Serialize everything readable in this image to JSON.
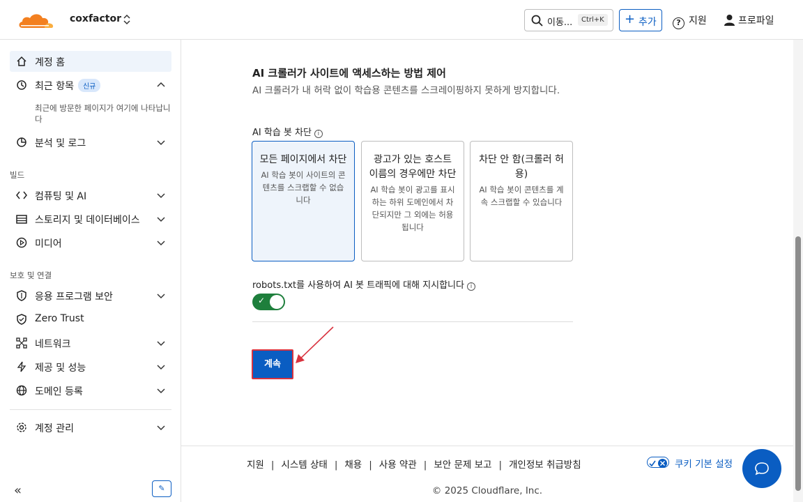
{
  "topbar": {
    "account_name": "coxfactor",
    "search_label": "이동...",
    "search_shortcut": "Ctrl+K",
    "add_label": "추가",
    "support_label": "지원",
    "profile_label": "프로파일"
  },
  "sidebar": {
    "home": "계정 홈",
    "recent": "최근 항목",
    "recent_badge": "신규",
    "recent_note": "최근에 방문한 페이지가 여기에 나타납니다",
    "analytics": "분석 및 로그",
    "section_build": "빌드",
    "compute": "컴퓨팅 및 AI",
    "storage": "스토리지 및 데이터베이스",
    "media": "미디어",
    "section_protect": "보호 및 연결",
    "app_security": "응용 프로그램 보안",
    "zero_trust": "Zero Trust",
    "network": "네트워크",
    "delivery": "제공 및 성능",
    "domain_reg": "도메인 등록",
    "account_mgmt": "계정 관리"
  },
  "main": {
    "title": "AI 크롤러가 사이트에 액세스하는 방법 제어",
    "description": "AI 크롤러가 내 허락 없이 학습용 콘텐츠를 스크레이핑하지 못하게 방지합니다.",
    "block_label": "AI 학습 봇 차단",
    "options": [
      {
        "title": "모든 페이지에서 차단",
        "desc": "AI 학습 봇이 사이트의 콘텐츠를 스크랩할 수 없습니다"
      },
      {
        "title": "광고가 있는 호스트 이름의 경우에만 차단",
        "desc": "AI 학습 봇이 광고를 표시하는 하위 도메인에서 차단되지만 그 외에는 허용됩니다"
      },
      {
        "title": "차단 안 함(크롤러 허용)",
        "desc": "AI 학습 봇이 콘텐츠를 계속 스크랩할 수 있습니다"
      }
    ],
    "robots_label": "robots.txt를 사용하여 AI 봇 트래픽에 대해 지시합니다",
    "robots_enabled": true,
    "continue_label": "계속"
  },
  "footer": {
    "links": [
      "지원",
      "시스템 상태",
      "채용",
      "사용 약관",
      "보안 문제 보고",
      "개인정보 취급방침"
    ],
    "cookie_label": "쿠키 기본 설정",
    "copyright": "© 2025 Cloudflare, Inc."
  },
  "colors": {
    "accent": "#0a5dc2",
    "brand_orange": "#f38020",
    "toggle_on": "#1e7f3c",
    "highlight": "#d9333f"
  }
}
